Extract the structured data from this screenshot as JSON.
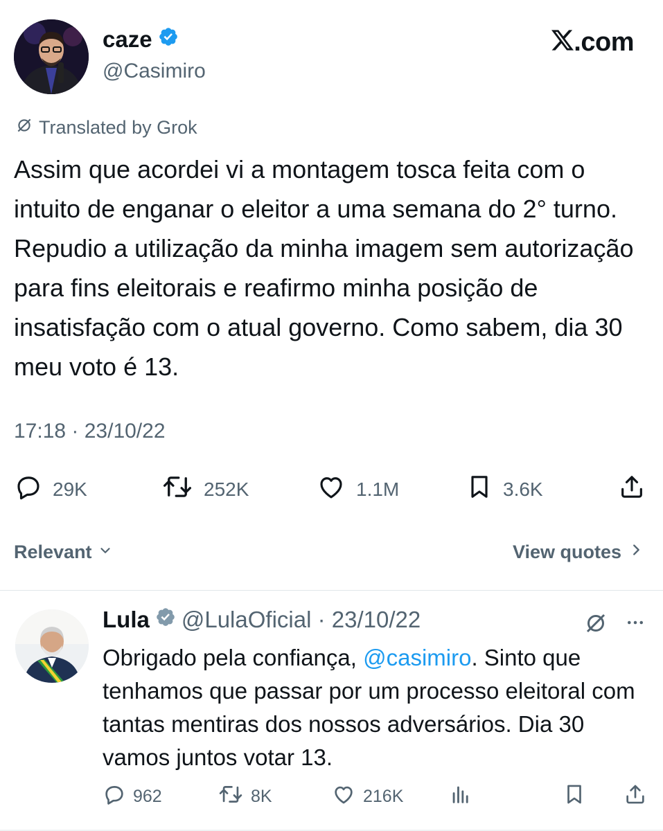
{
  "header": {
    "display_name": "caze",
    "handle": "@Casimiro",
    "site": ".com"
  },
  "tweet": {
    "translated_label": "Translated by Grok",
    "text": "Assim que acordei vi a montagem tosca feita com o intuito de enganar o eleitor a uma semana do 2° turno. Repudio a utilização da minha imagem sem autorização para fins eleitorais e reafirmo minha posição de insatisfação com o atual governo. Como sabem, dia 30 meu voto é 13.",
    "timestamp": "17:18 · 23/10/22",
    "stats": {
      "replies": "29K",
      "reposts": "252K",
      "likes": "1.1M",
      "bookmarks": "3.6K"
    }
  },
  "replies_bar": {
    "sort_label": "Relevant",
    "view_quotes_label": "View quotes"
  },
  "reply": {
    "display_name": "Lula",
    "handle_date": "@LulaOficial · 23/10/22",
    "text_before": "Obrigado pela confiança, ",
    "mention": "@casimiro",
    "text_after": ". Sinto que tenhamos que passar por um processo eleitoral com tantas mentiras dos nossos adversários. Dia 30 vamos juntos votar 13.",
    "stats": {
      "replies": "962",
      "reposts": "8K",
      "likes": "216K"
    }
  },
  "colors": {
    "verified": "#1d9bf0",
    "reply_verified": "#829aab",
    "muted": "#536471",
    "link": "#1d9bf0"
  },
  "icons": [
    "verified-badge-icon",
    "x-logo-icon",
    "translate-icon",
    "reply-icon",
    "repost-icon",
    "like-icon",
    "bookmark-icon",
    "share-icon",
    "chevron-down-icon",
    "chevron-right-icon",
    "more-icon",
    "views-icon"
  ]
}
